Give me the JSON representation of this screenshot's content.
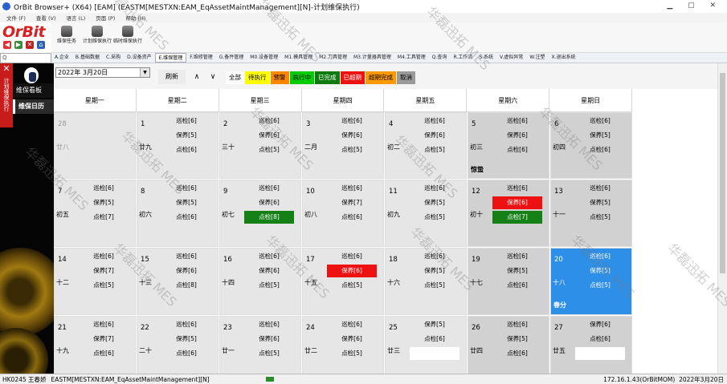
{
  "window": {
    "title": "OrBit Browser+ (X64) [EAM] (EASTM[MESTXN:EAM_EqAssetMaintManagement][N]-计划维保执行)",
    "controls": "▁ ▢ ✕"
  },
  "menubar": [
    "文件 (F)",
    "查看 (V)",
    "语言 (L)",
    "页面 (P)",
    "帮助 (H)"
  ],
  "logo": "OrBit",
  "toolbar": [
    {
      "label": "维保任务"
    },
    {
      "label": "计划维保执行"
    },
    {
      "label": "临时维保执行"
    }
  ],
  "search": {
    "value": "Q"
  },
  "nav": [
    "A.企业",
    "B.基础数据",
    "C.采购",
    "D.设备资产",
    "E.维保管理",
    "F.维修管理",
    "G.备件管理",
    "M0.设备管理",
    "M1.模具管理",
    "M2.刀具管理",
    "M3.计量器具管理",
    "M4.工具管理",
    "Q.查询",
    "R.工作流",
    "S.系统",
    "V.虚拟异常",
    "W.注塑",
    "X.退出系统"
  ],
  "nav_active": 4,
  "sidebar": {
    "strip_label": "计划维保执行",
    "items": [
      "维保看板",
      "维保日历"
    ],
    "active": 1
  },
  "datebar": {
    "date": "2022年 3月20日",
    "refresh": "刷新",
    "up": "∧",
    "down": "∨"
  },
  "legend": [
    {
      "label": "全部",
      "bg": "#ffffff",
      "fg": "#000000"
    },
    {
      "label": "待执行",
      "bg": "#ffff00",
      "fg": "#000000"
    },
    {
      "label": "预警",
      "bg": "#ff8800",
      "fg": "#000000"
    },
    {
      "label": "执行中",
      "bg": "#00cc00",
      "fg": "#000000"
    },
    {
      "label": "已完成",
      "bg": "#0d7a0d",
      "fg": "#ffffff"
    },
    {
      "label": "已超期",
      "bg": "#ee1111",
      "fg": "#ffffff"
    },
    {
      "label": "超期完成",
      "bg": "#ff9900",
      "fg": "#000000"
    },
    {
      "label": "取消",
      "bg": "#9a9a9a",
      "fg": "#000000"
    }
  ],
  "weekdays": [
    "星期一",
    "星期二",
    "星期三",
    "星期四",
    "星期五",
    "星期六",
    "星期日"
  ],
  "days": [
    {
      "day": "28",
      "lunar": "廿八",
      "other": true,
      "events": []
    },
    {
      "day": "1",
      "lunar": "廿九",
      "events": [
        {
          "t": "巡检[6]"
        },
        {
          "t": "保养[5]"
        },
        {
          "t": "点检[6]"
        }
      ]
    },
    {
      "day": "2",
      "lunar": "三十",
      "events": [
        {
          "t": "巡检[6]"
        },
        {
          "t": "保养[6]"
        },
        {
          "t": "点检[5]"
        }
      ]
    },
    {
      "day": "3",
      "lunar": "二月",
      "events": [
        {
          "t": "巡检[6]"
        },
        {
          "t": "保养[6]"
        },
        {
          "t": "点检[5]"
        }
      ]
    },
    {
      "day": "4",
      "lunar": "初二",
      "events": [
        {
          "t": "巡检[6]"
        },
        {
          "t": "保养[6]"
        },
        {
          "t": "点检[5]"
        }
      ]
    },
    {
      "day": "5",
      "lunar": "初三",
      "term": "惊蛰",
      "weekend": true,
      "events": [
        {
          "t": "巡检[6]"
        },
        {
          "t": "保养[6]"
        },
        {
          "t": "点检[6]"
        }
      ]
    },
    {
      "day": "6",
      "lunar": "初四",
      "weekend": true,
      "events": [
        {
          "t": "巡检[6]"
        },
        {
          "t": "保养[5]"
        },
        {
          "t": "点检[6]"
        }
      ]
    },
    {
      "day": "7",
      "lunar": "初五",
      "events": [
        {
          "t": "巡检[6]"
        },
        {
          "t": "保养[5]"
        },
        {
          "t": "点检[7]"
        }
      ]
    },
    {
      "day": "8",
      "lunar": "初六",
      "events": [
        {
          "t": "巡检[6]"
        },
        {
          "t": "保养[5]"
        },
        {
          "t": "点检[6]"
        }
      ]
    },
    {
      "day": "9",
      "lunar": "初七",
      "events": [
        {
          "t": "巡检[6]"
        },
        {
          "t": "保养[6]"
        },
        {
          "t": "点检[8]",
          "c": "green"
        }
      ]
    },
    {
      "day": "10",
      "lunar": "初八",
      "events": [
        {
          "t": "巡检[6]"
        },
        {
          "t": "保养[7]"
        },
        {
          "t": "点检[6]"
        }
      ]
    },
    {
      "day": "11",
      "lunar": "初九",
      "events": [
        {
          "t": "巡检[6]"
        },
        {
          "t": "保养[5]"
        },
        {
          "t": "点检[5]"
        }
      ]
    },
    {
      "day": "12",
      "lunar": "初十",
      "weekend": true,
      "events": [
        {
          "t": "巡检[6]"
        },
        {
          "t": "保养[6]",
          "c": "red"
        },
        {
          "t": "点检[7]",
          "c": "green"
        }
      ]
    },
    {
      "day": "13",
      "lunar": "十一",
      "weekend": true,
      "events": [
        {
          "t": "巡检[6]"
        },
        {
          "t": "保养[5]"
        },
        {
          "t": "点检[5]"
        }
      ]
    },
    {
      "day": "14",
      "lunar": "十二",
      "events": [
        {
          "t": "巡检[6]"
        },
        {
          "t": "保养[7]"
        },
        {
          "t": "点检[5]"
        }
      ]
    },
    {
      "day": "15",
      "lunar": "十三",
      "events": [
        {
          "t": "巡检[6]"
        },
        {
          "t": "保养[6]"
        },
        {
          "t": "点检[8]"
        }
      ]
    },
    {
      "day": "16",
      "lunar": "十四",
      "events": [
        {
          "t": "巡检[6]"
        },
        {
          "t": "保养[6]"
        },
        {
          "t": "点检[5]"
        }
      ]
    },
    {
      "day": "17",
      "lunar": "十五",
      "events": [
        {
          "t": "巡检[6]"
        },
        {
          "t": "保养[6]",
          "c": "red"
        },
        {
          "t": "点检[5]"
        }
      ]
    },
    {
      "day": "18",
      "lunar": "十六",
      "events": [
        {
          "t": "巡检[6]"
        },
        {
          "t": "保养[5]"
        },
        {
          "t": "点检[5]"
        }
      ]
    },
    {
      "day": "19",
      "lunar": "十七",
      "weekend": true,
      "events": [
        {
          "t": "巡检[6]"
        },
        {
          "t": "保养[5]"
        },
        {
          "t": "点检[6]"
        }
      ]
    },
    {
      "day": "20",
      "lunar": "十八",
      "term": "春分",
      "today": true,
      "events": [
        {
          "t": "巡检[6]"
        },
        {
          "t": "保养[5]"
        },
        {
          "t": "点检[5]"
        }
      ]
    },
    {
      "day": "21",
      "lunar": "十九",
      "events": [
        {
          "t": "巡检[6]"
        },
        {
          "t": "保养[7]"
        },
        {
          "t": "点检[6]"
        }
      ]
    },
    {
      "day": "22",
      "lunar": "二十",
      "events": [
        {
          "t": "巡检[6]"
        },
        {
          "t": "保养[5]"
        },
        {
          "t": "点检[6]"
        }
      ]
    },
    {
      "day": "23",
      "lunar": "廿一",
      "events": [
        {
          "t": "巡检[6]"
        },
        {
          "t": "保养[6]"
        },
        {
          "t": "点检[5]"
        }
      ]
    },
    {
      "day": "24",
      "lunar": "廿二",
      "events": [
        {
          "t": "巡检[6]"
        },
        {
          "t": "保养[6]"
        },
        {
          "t": "点检[5]"
        }
      ]
    },
    {
      "day": "25",
      "lunar": "廿三",
      "events": [
        {
          "t": "保养[5]"
        },
        {
          "t": "点检[6]"
        },
        {
          "t": "",
          "c": "white"
        }
      ]
    },
    {
      "day": "26",
      "lunar": "廿四",
      "weekend": true,
      "events": [
        {
          "t": "巡检[6]"
        },
        {
          "t": "保养[5]"
        },
        {
          "t": "点检[6]"
        }
      ]
    },
    {
      "day": "27",
      "lunar": "廿五",
      "weekend": true,
      "events": [
        {
          "t": "保养[6]"
        },
        {
          "t": "点检[6]"
        },
        {
          "t": "",
          "c": "white"
        }
      ]
    }
  ],
  "statusbar": {
    "user": "HK0245 王春娇",
    "module": "EASTM[MESTXN:EAM_EqAssetMaintManagement][N]",
    "server": "172.16.1.43(OrBitMOM)",
    "date": "2022年3月20日"
  },
  "watermark": "华磊迅拓 MES"
}
